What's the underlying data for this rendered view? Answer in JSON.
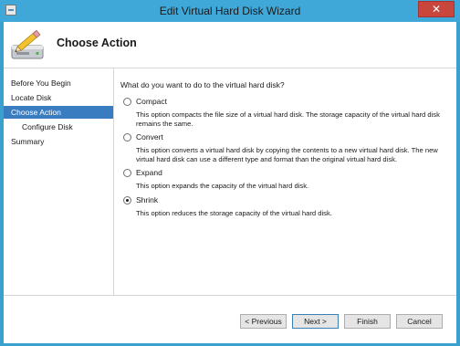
{
  "window": {
    "title": "Edit Virtual Hard Disk Wizard",
    "close_glyph": "✕"
  },
  "header": {
    "page_title": "Choose Action"
  },
  "sidebar": {
    "items": [
      {
        "label": "Before You Begin"
      },
      {
        "label": "Locate Disk"
      },
      {
        "label": "Choose Action"
      },
      {
        "label": "Configure Disk"
      },
      {
        "label": "Summary"
      }
    ]
  },
  "main": {
    "question": "What do you want to do to the virtual hard disk?",
    "options": [
      {
        "label": "Compact",
        "checked": false,
        "description": "This option compacts the file size of a virtual hard disk. The storage capacity of the virtual hard disk remains the same."
      },
      {
        "label": "Convert",
        "checked": false,
        "description": "This option converts a virtual hard disk by copying the contents to a new virtual hard disk. The new virtual hard disk can use a different type and format than the original virtual hard disk."
      },
      {
        "label": "Expand",
        "checked": false,
        "description": "This option expands the capacity of the virtual hard disk."
      },
      {
        "label": "Shrink",
        "checked": true,
        "description": "This option reduces the storage capacity of the virtual hard disk."
      }
    ]
  },
  "footer": {
    "previous_label": "< Previous",
    "next_label": "Next >",
    "finish_label": "Finish",
    "cancel_label": "Cancel"
  },
  "colors": {
    "titlebar": "#3fa8d8",
    "selection": "#3a7cc0",
    "close": "#c9463d"
  },
  "icons": {
    "wizard": "disk-pencil-icon",
    "app": "app-window-icon",
    "close": "close-icon"
  }
}
